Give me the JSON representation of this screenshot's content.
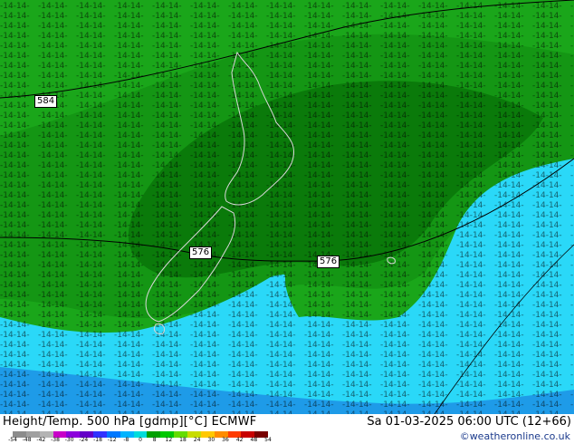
{
  "map": {
    "contour_labels": [
      "584",
      "576",
      "576"
    ],
    "colors": {
      "dark_green": "#0a7a0a",
      "mid_green": "#149614",
      "light_green": "#1aa61a",
      "blue": "#1e9be8",
      "cyan": "#2ad8f8",
      "land_outline": "#d8d8d8"
    }
  },
  "footer": {
    "title": "Height/Temp. 500 hPa [gdmp][°C] ECMWF",
    "datetime": "Sa 01-03-2025 06:00 UTC (12+66)",
    "credit": "©weatheronline.co.uk"
  },
  "legend": {
    "ticks": [
      "-54",
      "-48",
      "-42",
      "-38",
      "-30",
      "-24",
      "-18",
      "-12",
      "-8",
      "0",
      "8",
      "12",
      "18",
      "24",
      "30",
      "36",
      "42",
      "48",
      "54"
    ],
    "colors": [
      "#8c8c8c",
      "#a0a0a0",
      "#b4b4b4",
      "#c800c8",
      "#8c00dc",
      "#6400c8",
      "#3232ff",
      "#0078ff",
      "#00b4ff",
      "#00dcdc",
      "#00a000",
      "#00c800",
      "#64dc00",
      "#c8dc00",
      "#ffc800",
      "#ff8c00",
      "#ff3c00",
      "#c80000",
      "#780000"
    ]
  }
}
